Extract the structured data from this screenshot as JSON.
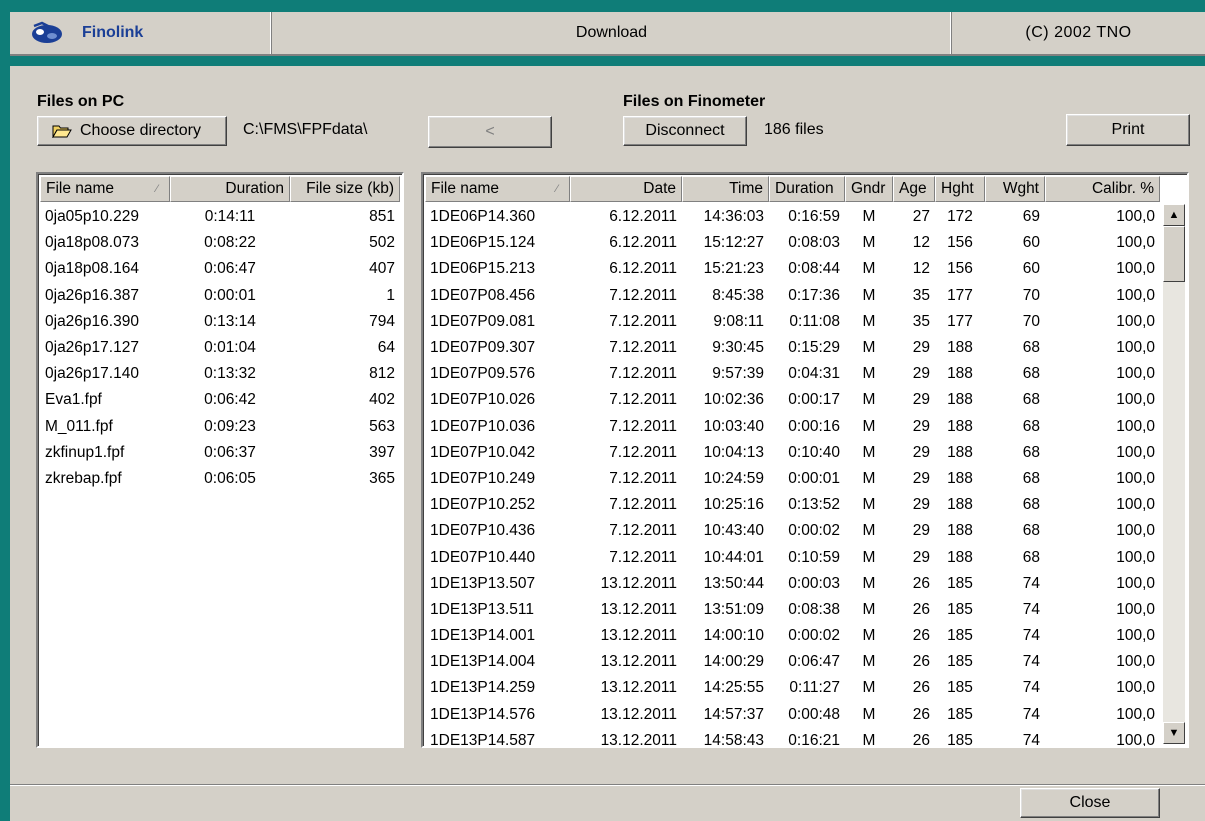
{
  "header": {
    "brand": "Finolink",
    "mode": "Download",
    "copyright": "(C) 2002 TNO"
  },
  "pc": {
    "title": "Files on PC",
    "choose_dir_label": "Choose directory",
    "path": "C:\\FMS\\FPFdata\\",
    "columns": [
      "File name",
      "Duration",
      "File size (kb)"
    ],
    "rows": [
      [
        "0ja05p10.229",
        "0:14:11",
        "851"
      ],
      [
        "0ja18p08.073",
        "0:08:22",
        "502"
      ],
      [
        "0ja18p08.164",
        "0:06:47",
        "407"
      ],
      [
        "0ja26p16.387",
        "0:00:01",
        "1"
      ],
      [
        "0ja26p16.390",
        "0:13:14",
        "794"
      ],
      [
        "0ja26p17.127",
        "0:01:04",
        "64"
      ],
      [
        "0ja26p17.140",
        "0:13:32",
        "812"
      ],
      [
        "Eva1.fpf",
        "0:06:42",
        "402"
      ],
      [
        "M_011.fpf",
        "0:09:23",
        "563"
      ],
      [
        "zkfinup1.fpf",
        "0:06:37",
        "397"
      ],
      [
        "zkrebap.fpf",
        "0:06:05",
        "365"
      ]
    ]
  },
  "transfer_button_label": "<",
  "fino": {
    "title": "Files on Finometer",
    "disconnect_label": "Disconnect",
    "file_count": "186 files",
    "print_label": "Print",
    "columns": [
      "File name",
      "Date",
      "Time",
      "Duration",
      "Gndr",
      "Age",
      "Hght",
      "Wght",
      "Calibr. %"
    ],
    "rows": [
      [
        "1DE06P14.360",
        "6.12.2011",
        "14:36:03",
        "0:16:59",
        "M",
        "27",
        "172",
        "69",
        "100,0"
      ],
      [
        "1DE06P15.124",
        "6.12.2011",
        "15:12:27",
        "0:08:03",
        "M",
        "12",
        "156",
        "60",
        "100,0"
      ],
      [
        "1DE06P15.213",
        "6.12.2011",
        "15:21:23",
        "0:08:44",
        "M",
        "12",
        "156",
        "60",
        "100,0"
      ],
      [
        "1DE07P08.456",
        "7.12.2011",
        "8:45:38",
        "0:17:36",
        "M",
        "35",
        "177",
        "70",
        "100,0"
      ],
      [
        "1DE07P09.081",
        "7.12.2011",
        "9:08:11",
        "0:11:08",
        "M",
        "35",
        "177",
        "70",
        "100,0"
      ],
      [
        "1DE07P09.307",
        "7.12.2011",
        "9:30:45",
        "0:15:29",
        "M",
        "29",
        "188",
        "68",
        "100,0"
      ],
      [
        "1DE07P09.576",
        "7.12.2011",
        "9:57:39",
        "0:04:31",
        "M",
        "29",
        "188",
        "68",
        "100,0"
      ],
      [
        "1DE07P10.026",
        "7.12.2011",
        "10:02:36",
        "0:00:17",
        "M",
        "29",
        "188",
        "68",
        "100,0"
      ],
      [
        "1DE07P10.036",
        "7.12.2011",
        "10:03:40",
        "0:00:16",
        "M",
        "29",
        "188",
        "68",
        "100,0"
      ],
      [
        "1DE07P10.042",
        "7.12.2011",
        "10:04:13",
        "0:10:40",
        "M",
        "29",
        "188",
        "68",
        "100,0"
      ],
      [
        "1DE07P10.249",
        "7.12.2011",
        "10:24:59",
        "0:00:01",
        "M",
        "29",
        "188",
        "68",
        "100,0"
      ],
      [
        "1DE07P10.252",
        "7.12.2011",
        "10:25:16",
        "0:13:52",
        "M",
        "29",
        "188",
        "68",
        "100,0"
      ],
      [
        "1DE07P10.436",
        "7.12.2011",
        "10:43:40",
        "0:00:02",
        "M",
        "29",
        "188",
        "68",
        "100,0"
      ],
      [
        "1DE07P10.440",
        "7.12.2011",
        "10:44:01",
        "0:10:59",
        "M",
        "29",
        "188",
        "68",
        "100,0"
      ],
      [
        "1DE13P13.507",
        "13.12.2011",
        "13:50:44",
        "0:00:03",
        "M",
        "26",
        "185",
        "74",
        "100,0"
      ],
      [
        "1DE13P13.511",
        "13.12.2011",
        "13:51:09",
        "0:08:38",
        "M",
        "26",
        "185",
        "74",
        "100,0"
      ],
      [
        "1DE13P14.001",
        "13.12.2011",
        "14:00:10",
        "0:00:02",
        "M",
        "26",
        "185",
        "74",
        "100,0"
      ],
      [
        "1DE13P14.004",
        "13.12.2011",
        "14:00:29",
        "0:06:47",
        "M",
        "26",
        "185",
        "74",
        "100,0"
      ],
      [
        "1DE13P14.259",
        "13.12.2011",
        "14:25:55",
        "0:11:27",
        "M",
        "26",
        "185",
        "74",
        "100,0"
      ],
      [
        "1DE13P14.576",
        "13.12.2011",
        "14:57:37",
        "0:00:48",
        "M",
        "26",
        "185",
        "74",
        "100,0"
      ],
      [
        "1DE13P14.587",
        "13.12.2011",
        "14:58:43",
        "0:16:21",
        "M",
        "26",
        "185",
        "74",
        "100,0"
      ]
    ]
  },
  "close_label": "Close",
  "colors": {
    "frame_teal": "#0f7d78",
    "brand_blue": "#1b3f96",
    "face": "#d4d0c8"
  },
  "icons": {
    "logo": "tno-logo-icon",
    "folder": "folder-open-icon",
    "sort": "sort-arrow-icon"
  }
}
